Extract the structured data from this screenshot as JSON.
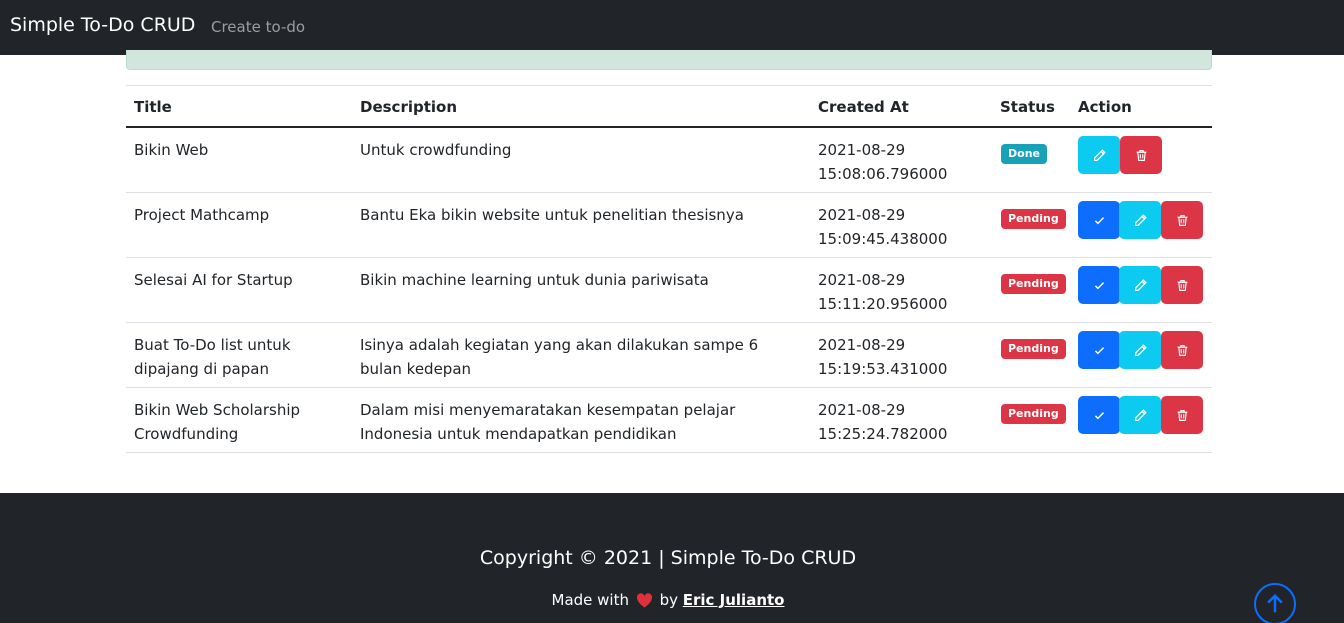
{
  "navbar": {
    "brand": "Simple To-Do CRUD",
    "create_link": "Create to-do"
  },
  "table": {
    "headers": {
      "title": "Title",
      "description": "Description",
      "created_at": "Created At",
      "status": "Status",
      "action": "Action"
    },
    "rows": [
      {
        "title": "Bikin Web",
        "description": "Untuk crowdfunding",
        "date": "2021-08-29",
        "time": "15:08:06.796000",
        "status": "Done"
      },
      {
        "title": "Project Mathcamp",
        "description": "Bantu Eka bikin website untuk penelitian thesisnya",
        "date": "2021-08-29",
        "time": "15:09:45.438000",
        "status": "Pending"
      },
      {
        "title": "Selesai AI for Startup",
        "description": "Bikin machine learning untuk dunia pariwisata",
        "date": "2021-08-29",
        "time": "15:11:20.956000",
        "status": "Pending"
      },
      {
        "title": "Buat To-Do list untuk dipajang di papan",
        "description": "Isinya adalah kegiatan yang akan dilakukan sampe 6 bulan kedepan",
        "date": "2021-08-29",
        "time": "15:19:53.431000",
        "status": "Pending"
      },
      {
        "title": "Bikin Web Scholarship Crowdfunding",
        "description": "Dalam misi menyemaratakan kesempatan pelajar Indonesia untuk mendapatkan pendidikan",
        "date": "2021-08-29",
        "time": "15:25:24.782000",
        "status": "Pending"
      }
    ]
  },
  "footer": {
    "copyright": "Copyright © 2021 | Simple To-Do CRUD",
    "made_with": "Made with",
    "by": "by",
    "author": "Eric Julianto"
  },
  "colors": {
    "navbar_bg": "#212529",
    "done_badge": "#17a2b8",
    "pending_badge": "#dc3545",
    "primary": "#0d6efd",
    "info": "#0dcaf0",
    "danger": "#dc3545",
    "heart": "#e0313a"
  },
  "icons": {
    "mark_done": "check-icon",
    "edit": "pencil-icon",
    "delete": "trash-icon",
    "scroll_top": "arrow-up-circle-icon",
    "love": "heart-icon"
  }
}
